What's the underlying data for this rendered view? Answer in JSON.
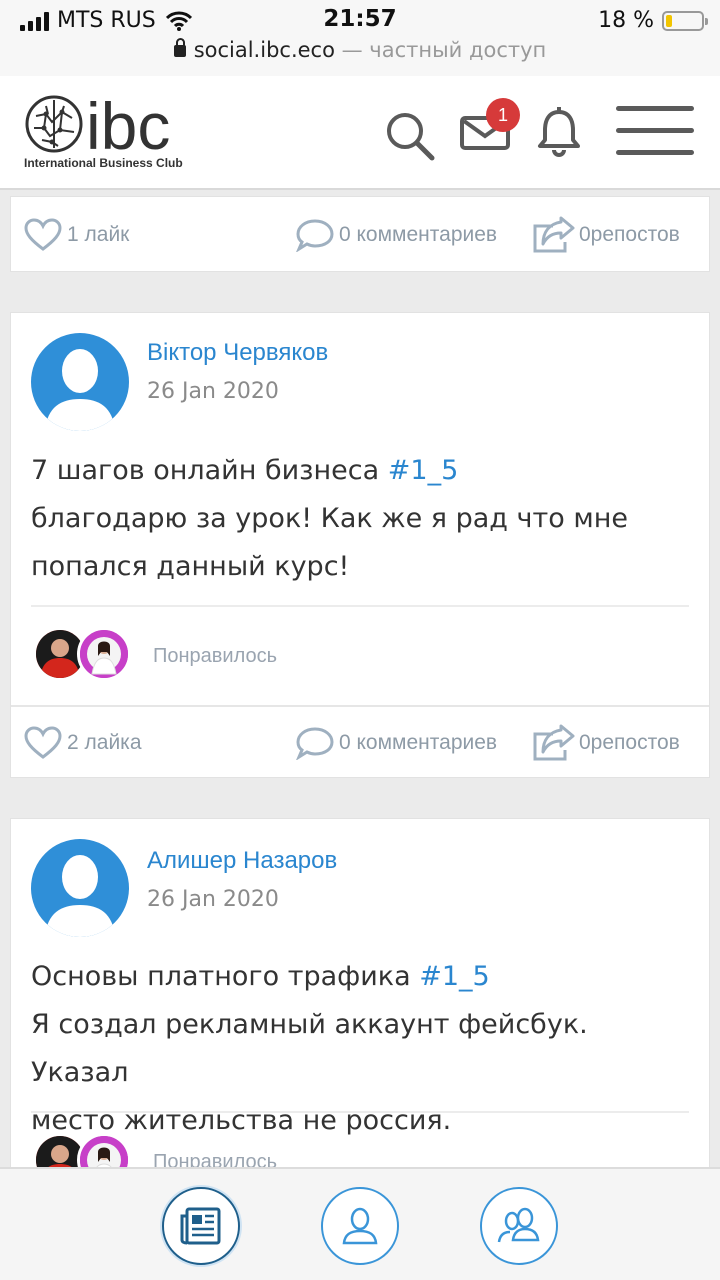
{
  "status_bar": {
    "carrier": "MTS RUS",
    "time": "21:57",
    "battery_percent": "18 %",
    "battery_level": 0.18
  },
  "url_bar": {
    "domain": "social.ibc.eco",
    "separator": " — ",
    "privacy_label": "частный доступ"
  },
  "header": {
    "logo_text": "ibc",
    "logo_caption": "International Business Club",
    "messages_badge": "1"
  },
  "feed": {
    "top_card_actions": {
      "likes": "1 лайк",
      "comments": "0 комментариев",
      "reposts": "0репостов"
    },
    "posts": [
      {
        "author": "Віктор Червяков",
        "date": "26 Jan 2020",
        "line1_prefix": "7 шагов онлайн бизнеса ",
        "hashtag": "#1_5",
        "line2": "благодарю за урок! Как же я рад что мне",
        "line3": "попался данный курс!",
        "liked_label": "Понравилось",
        "likes": "2 лайка",
        "comments": "0 комментариев",
        "reposts": "0репостов"
      },
      {
        "author": "Алишер Назаров",
        "date": "26 Jan 2020",
        "line1_prefix": "Основы платного трафика ",
        "hashtag": "#1_5",
        "line2": "Я создал рекламный аккаунт фейсбук. Указал",
        "line3": "место жительства не россия.",
        "liked_label": "Понравилось"
      }
    ]
  },
  "icons": {
    "search": "search-icon",
    "messages": "envelope-icon",
    "notifications": "bell-icon",
    "menu": "hamburger-menu-icon",
    "like": "heart-icon",
    "comment": "speech-bubble-icon",
    "repost": "share-icon",
    "nav_feed": "newspaper-icon",
    "nav_profile": "user-icon",
    "nav_people": "users-icon"
  },
  "colors": {
    "accent": "#2a86cf",
    "badge": "#d63a3a",
    "avatar": "#2f8fd8",
    "muted": "#8d9aa6"
  }
}
